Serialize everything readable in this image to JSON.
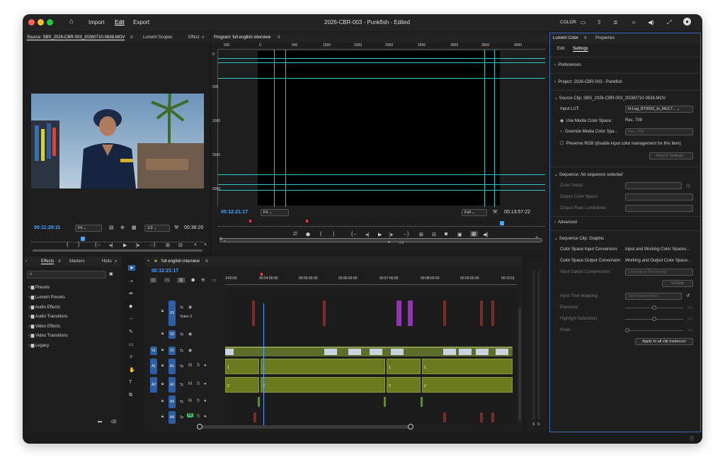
{
  "titlebar": {
    "menu": [
      "Import",
      "Edit",
      "Export"
    ],
    "title": "2026-CBR-003 - Punkfish - Edited",
    "workspace": "COLOR"
  },
  "source": {
    "tabs": [
      "Source: SBS_2026-CBR-003_20260710-0638.MOV",
      "Lumetri Scopes",
      "Effect"
    ],
    "timecode_in": "00:11:29:11",
    "zoom": "Fit",
    "resolution": "1/2",
    "timecode_out": "00:38:20"
  },
  "program": {
    "tab": "Program: full english interview",
    "ruler_labels": [
      "500",
      "0",
      "500",
      "1000",
      "1500",
      "2000",
      "2500",
      "3000",
      "3500",
      "4000"
    ],
    "vruler_labels": [
      "0",
      "500",
      "1000",
      "1500",
      "2000"
    ],
    "timecode_in": "00:12:21:17",
    "zoom": "Fit",
    "quality": "Full",
    "timecode_out": "00:13:57:22"
  },
  "effects": {
    "tabs": [
      "Effects",
      "Markers",
      "Histo"
    ],
    "items": [
      "Presets",
      "Lumetri Presets",
      "Audio Effects",
      "Audio Transitions",
      "Video Effects",
      "Video Transitions",
      "Legacy"
    ]
  },
  "timeline": {
    "tab": "full english interview",
    "timecode": "00:12:21:17",
    "ruler": [
      "3:00:00",
      "00:04:00:00",
      "00:05:00:00",
      "00:06:00:00",
      "00:07:00:00",
      "00:08:00:00",
      "00:09:00:00",
      "00:10:0("
    ],
    "tracks": [
      {
        "target": "",
        "name": "V3",
        "label": "Video 3"
      },
      {
        "target": "",
        "name": "V2",
        "label": ""
      },
      {
        "target": "V1",
        "name": "V1",
        "label": ""
      },
      {
        "target": "A1",
        "name": "A1",
        "label": ""
      },
      {
        "target": "A2",
        "name": "A2",
        "label": ""
      },
      {
        "target": "",
        "name": "A3",
        "label": ""
      },
      {
        "target": "",
        "name": "A4",
        "label": ""
      }
    ],
    "track_letters": {
      "mute": "M",
      "solo": "S"
    },
    "clip_nums": [
      "1",
      "1",
      "1",
      "1",
      "2",
      "2",
      "2",
      "2"
    ]
  },
  "lumetri": {
    "tabs": [
      "Lumetri Color",
      "Properties"
    ],
    "subtabs": [
      "Edit",
      "Settings"
    ],
    "preferences": "Preferences",
    "project": "Project: 2026-CBR-003 - Punkfish",
    "source_clip": "Source Clip: SBS_2026-CBR-003_20260710-0638.MOV",
    "input_lut_label": "Input LUT:",
    "input_lut_value": "N-Log_BT2020_to_REC7...",
    "use_media_label": "Use Media Color Space:",
    "use_media_value": "Rec. 709",
    "override_label": "Override Media Color Spa...",
    "override_value": "Rec. 709",
    "preserve_rgb": "Preserve RGB (disable input color management for this item)",
    "source_settings": "Source Settings...",
    "sequence_label": "Sequence:",
    "sequence_value": "No sequence selected",
    "color_setup": "Color Setup:",
    "output_cs": "Output Color Space:",
    "output_peak": "Output Peak Luminance:",
    "advanced": "Advanced",
    "seq_clip": "Sequence Clip: Graphic",
    "cs_input_label": "Color Space Input Conversion:",
    "cs_input_value": "Input and Working Color Spaces...",
    "cs_output_label": "Color Space Output Conversion:",
    "cs_output_value": "Working and Output Color Space...",
    "gamut_label": "Input Gamut Compression:",
    "gamut_value": "Luminance Preserving",
    "default_btn": "Default",
    "tone_label": "Input Tone Mapping:",
    "tone_value": "Hue Preservation",
    "exposure": "Exposure:",
    "highlight": "Highlight Saturation:",
    "knee": "Knee:",
    "slider_val": "0.0",
    "apply_btn": "Apply to all clip instances"
  },
  "meter_labels": [
    "S",
    "S"
  ],
  "colors": {
    "accent": "#4da3ff",
    "guide": "#2ec6c6",
    "audio": "#6b7a1e",
    "video": "#7a8a3a",
    "target": "#2d5ea8"
  }
}
